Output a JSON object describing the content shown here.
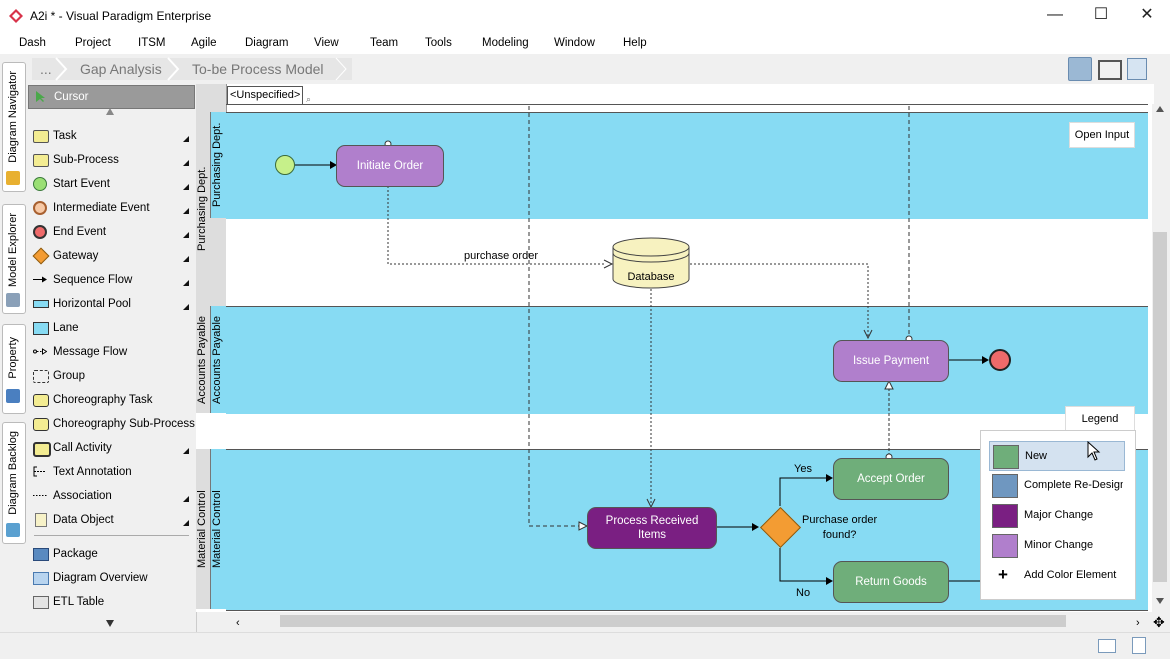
{
  "window": {
    "title": "A2i * - Visual Paradigm Enterprise",
    "minimize": "—",
    "maximize": "☐",
    "close": "✕"
  },
  "menu": [
    "Dash",
    "Project",
    "ITSM",
    "Agile",
    "Diagram",
    "View",
    "Team",
    "Tools",
    "Modeling",
    "Window",
    "Help"
  ],
  "breadcrumb": [
    "...",
    "Gap Analysis",
    "To-be Process Model"
  ],
  "left_tabs": [
    "Diagram Navigator",
    "Model Explorer",
    "Property",
    "Diagram Backlog"
  ],
  "palette": {
    "cursor": "Cursor",
    "items": [
      "Task",
      "Sub-Process",
      "Start Event",
      "Intermediate Event",
      "End Event",
      "Gateway",
      "Sequence Flow",
      "Horizontal Pool",
      "Lane",
      "Message Flow",
      "Group",
      "Choreography Task",
      "Choreography Sub-Process",
      "Call Activity",
      "Text Annotation",
      "Association",
      "Data Object"
    ],
    "extra_items": [
      "Package",
      "Diagram Overview",
      "ETL Table"
    ]
  },
  "diagram": {
    "filter": "<Unspecified>",
    "open_input": "Open Input",
    "lanes": [
      "Purchasing Dept.",
      "Accounts Payable",
      "Material Control"
    ],
    "tasks": {
      "initiate_order": "Initiate Order",
      "issue_payment": "Issue Payment",
      "accept_order": "Accept Order",
      "return_goods": "Return Goods",
      "process_received": "Process Received\nItems"
    },
    "database": "Database",
    "gateway": "Purchase order\nfound?",
    "labels": {
      "purchase_order": "purchase order",
      "yes": "Yes",
      "no": "No"
    },
    "colors": {
      "lane": "#87dbf3",
      "minor_change": "#b07fcc",
      "major_change": "#7a1f82",
      "new": "#6fae7a",
      "gateway": "#f39c33",
      "start_event": "#c6f08a",
      "end_event": "#ef6a6a"
    }
  },
  "legend": {
    "title": "Legend",
    "items": [
      {
        "label": "New",
        "color": "#6fae7a"
      },
      {
        "label": "Complete Re-Design",
        "color": "#6f97c0"
      },
      {
        "label": "Major Change",
        "color": "#7a1f82"
      },
      {
        "label": "Minor Change",
        "color": "#b07fcc"
      }
    ],
    "add": "Add Color Element"
  }
}
